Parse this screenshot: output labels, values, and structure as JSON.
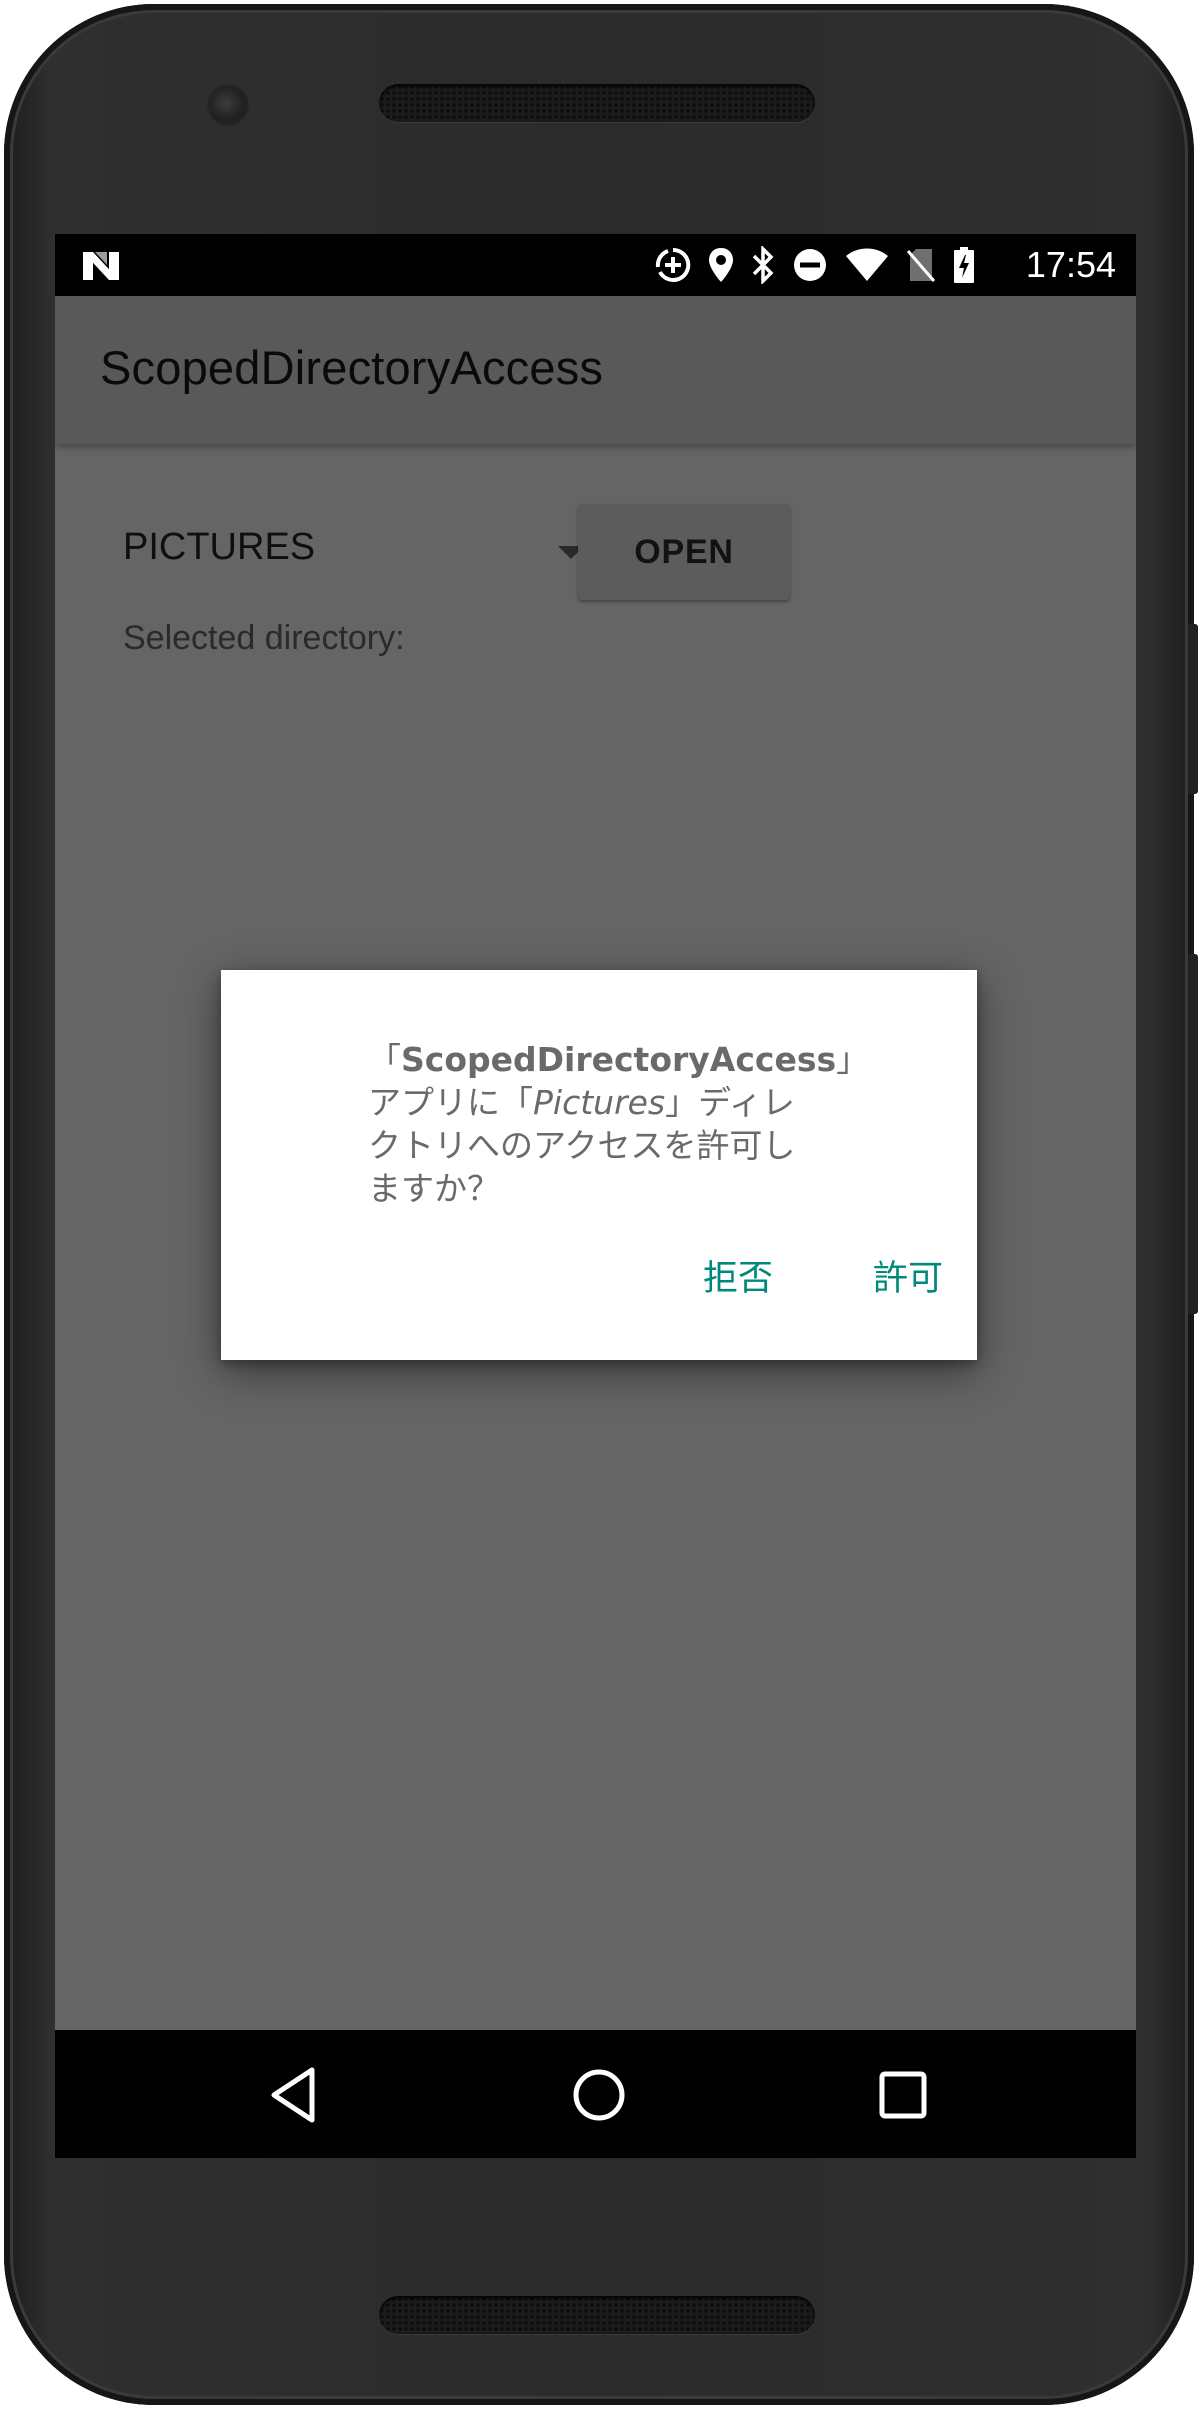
{
  "status_bar": {
    "time": "17:54",
    "icons": [
      "notification-n-icon",
      "data-saver-icon",
      "location-icon",
      "bluetooth-icon",
      "do-not-disturb-icon",
      "wifi-icon",
      "no-sim-icon",
      "battery-charging-icon"
    ]
  },
  "app_bar": {
    "title": "ScopedDirectoryAccess"
  },
  "main": {
    "directory_spinner": {
      "selected_value": "PICTURES"
    },
    "open_button_label": "OPEN",
    "selected_directory_label": "Selected directory:"
  },
  "dialog": {
    "line1_prefix": "「",
    "line1_app": "ScopedDirectoryAccess",
    "line1_suffix": "」",
    "line2_prefix": "アプリに「",
    "line2_dir": "Pictures",
    "line2_suffix": "」ディレ",
    "line3": "クトリへのアクセスを許可し",
    "line4": "ますか？",
    "deny_label": "拒否",
    "allow_label": "許可",
    "accent_color": "#00897b"
  },
  "nav_bar": {
    "icons": [
      "back-icon",
      "home-icon",
      "recents-icon"
    ]
  }
}
